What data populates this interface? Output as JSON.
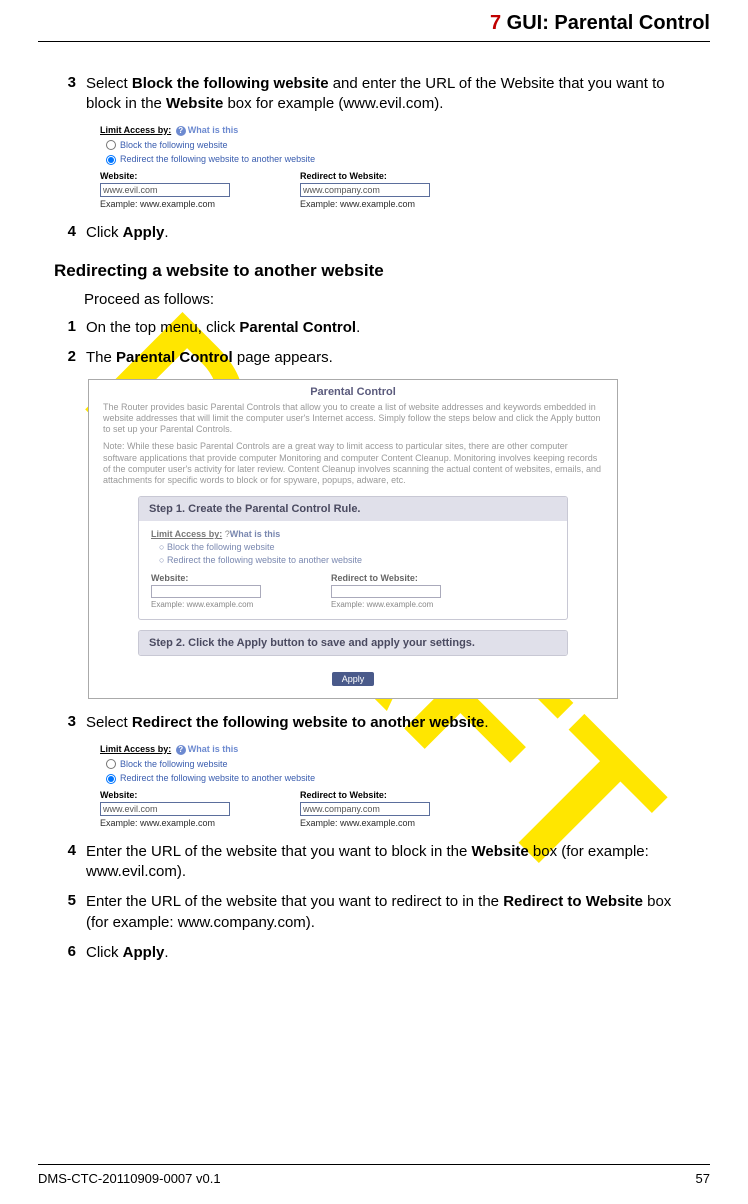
{
  "header": {
    "chapter_number": "7",
    "chapter_title": "GUI: Parental Control"
  },
  "top_steps": {
    "s3": {
      "num": "3",
      "pre": "Select ",
      "bold1": "Block the following website",
      "mid": " and enter the URL of the Website that you want to block in the ",
      "bold2": "Website",
      "post": " box for example (www.evil.com)."
    },
    "s4": {
      "num": "4",
      "pre": "Click ",
      "bold1": "Apply",
      "post": "."
    }
  },
  "subheading": "Redirecting a website to another website",
  "proceed": "Proceed as follows:",
  "mid_steps": {
    "s1": {
      "num": "1",
      "pre": "On the top menu, click ",
      "bold1": "Parental Control",
      "post": "."
    },
    "s2": {
      "num": "2",
      "pre": "The ",
      "bold1": "Parental Control",
      "post": " page appears."
    },
    "s3": {
      "num": "3",
      "pre": "Select ",
      "bold1": "Redirect the following website to another website",
      "post": "."
    },
    "s4": {
      "num": "4",
      "pre": "Enter the URL of the website that you want to block in the ",
      "bold1": "Website",
      "post": " box (for example: www.evil.com)."
    },
    "s5": {
      "num": "5",
      "pre": "Enter the URL of the website that you want to redirect to in the ",
      "bold1": "Redirect to Website",
      "post": " box (for example: www.company.com)."
    },
    "s6": {
      "num": "6",
      "pre": "Click ",
      "bold1": "Apply",
      "post": "."
    }
  },
  "mini_form": {
    "limit_label": "Limit Access by:",
    "what_is_this": "What is this",
    "opt_block": "Block the following website",
    "opt_redirect": "Redirect the following website to another website",
    "website_label": "Website:",
    "website_value": "www.evil.com",
    "website_example": "Example: www.example.com",
    "redirect_label": "Redirect to Website:",
    "redirect_value": "www.company.com",
    "redirect_example": "Example: www.example.com"
  },
  "big_fig": {
    "title": "Parental Control",
    "intro1": "The Router provides basic Parental Controls that allow you to create a list of website addresses and keywords embedded in website addresses that will limit the computer user's Internet access. Simply follow the steps below and click the Apply button to set up your Parental Controls.",
    "intro2": "Note: While these basic Parental Controls are a great way to limit access to particular sites, there are other computer software applications that provide computer Monitoring and computer Content Cleanup. Monitoring involves keeping records of the computer user's activity for later review. Content Cleanup involves scanning the actual content of websites, emails, and attachments for specific words to block or for spyware, popups, adware, etc.",
    "step1_head": "Step 1. Create the Parental Control Rule.",
    "limit_label": "Limit Access by:",
    "what_is_this": "What is this",
    "opt_block": "Block the following website",
    "opt_redirect": "Redirect the following website to another website",
    "website_label": "Website:",
    "website_example": "Example: www.example.com",
    "redirect_label": "Redirect to Website:",
    "redirect_example": "Example: www.example.com",
    "step2_head": "Step 2. Click the Apply button to save and apply your settings.",
    "apply": "Apply"
  },
  "footer": {
    "docid": "DMS-CTC-20110909-0007 v0.1",
    "page": "57"
  },
  "watermark": "DRAFT"
}
